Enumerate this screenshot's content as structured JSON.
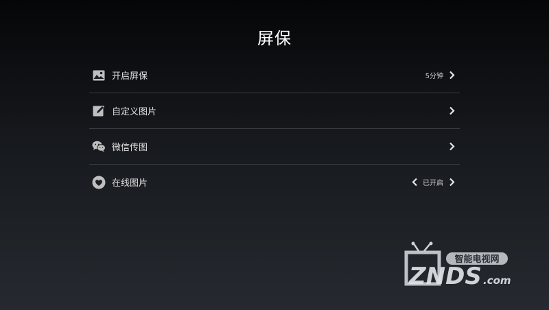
{
  "page": {
    "title": "屏保"
  },
  "menu": {
    "items": [
      {
        "label": "开启屏保",
        "value": "5分钟",
        "icon": "landscape-image-icon",
        "has_left_arrow": false
      },
      {
        "label": "自定义图片",
        "value": "",
        "icon": "edit-icon",
        "has_left_arrow": false
      },
      {
        "label": "微信传图",
        "value": "",
        "icon": "wechat-icon",
        "has_left_arrow": false
      },
      {
        "label": "在线图片",
        "value": "已开启",
        "icon": "heart-icon",
        "has_left_arrow": true
      }
    ]
  },
  "watermark": {
    "line1": "智能电视网",
    "line2": "ZNDS",
    "suffix": ".com"
  },
  "colors": {
    "divider": "#3a3e44",
    "icon": "#bfbfbf",
    "text": "#e0e0e0"
  }
}
